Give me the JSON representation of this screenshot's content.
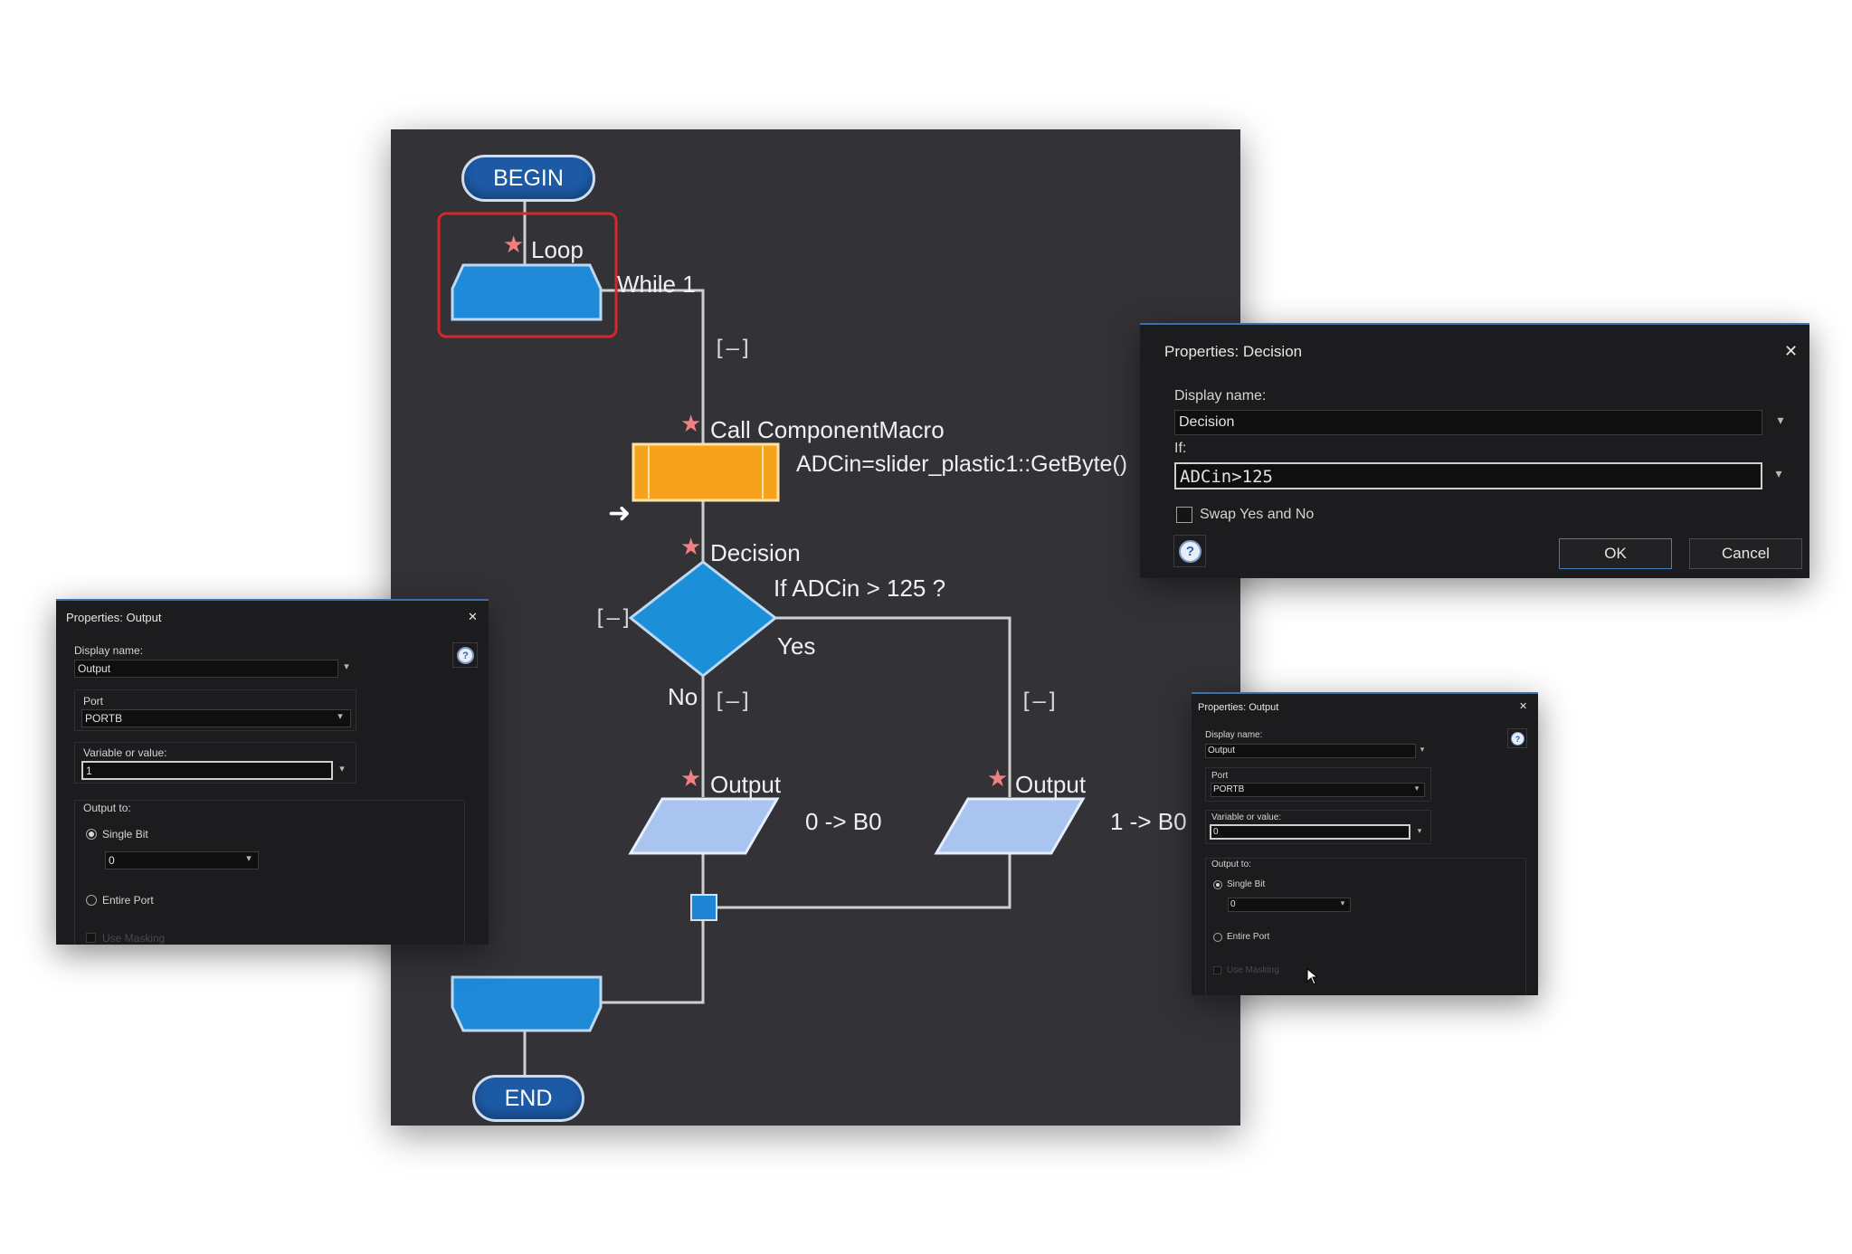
{
  "flowchart": {
    "begin_label": "BEGIN",
    "end_label": "END",
    "loop": {
      "title": "Loop",
      "condition": "While 1"
    },
    "call_macro": {
      "title": "Call ComponentMacro",
      "command": "ADCin=slider_plastic1::GetByte()"
    },
    "decision": {
      "title": "Decision",
      "condition": "If ADCin > 125 ?",
      "yes_label": "Yes",
      "no_label": "No"
    },
    "output_left": {
      "title": "Output",
      "command": "0 -> B0"
    },
    "output_right": {
      "title": "Output",
      "command": "1 -> B0"
    },
    "collapse_glyph": "[–]",
    "star_glyph": "★",
    "arrow_glyph": "➜",
    "colors": {
      "canvas_bg": "#333236",
      "terminal": "#1d5aa6",
      "loop_fill": "#1e8ad8",
      "macro_fill": "#f7a21b",
      "decision_fill": "#1c8fd9",
      "output_fill": "#a9c4ee",
      "connector": "#1f86d6",
      "selection": "#d8262c"
    }
  },
  "decision_dialog": {
    "title": "Properties: Decision",
    "close_glyph": "✕",
    "display_name_label": "Display name:",
    "display_name_value": "Decision",
    "if_label": "If:",
    "if_value": "ADCin>125",
    "swap_label": "Swap Yes and No",
    "swap_checked": false,
    "help_glyph": "?",
    "ok_label": "OK",
    "cancel_label": "Cancel",
    "drop_glyph": "▾"
  },
  "output_dialog_left": {
    "title": "Properties: Output",
    "close_glyph": "✕",
    "display_name_label": "Display name:",
    "display_name_value": "Output",
    "port_label": "Port",
    "port_value": "PORTB",
    "variable_label": "Variable or value:",
    "variable_value": "1",
    "output_to_label": "Output to:",
    "single_bit_label": "Single Bit",
    "single_bit_value": "0",
    "entire_port_label": "Entire Port",
    "use_masking_label": "Use Masking",
    "help_glyph": "?",
    "drop_glyph": "▾"
  },
  "output_dialog_right": {
    "title": "Properties: Output",
    "close_glyph": "✕",
    "display_name_label": "Display name:",
    "display_name_value": "Output",
    "port_label": "Port",
    "port_value": "PORTB",
    "variable_label": "Variable or value:",
    "variable_value": "0",
    "output_to_label": "Output to:",
    "single_bit_label": "Single Bit",
    "single_bit_value": "0",
    "entire_port_label": "Entire Port",
    "use_masking_label": "Use Masking",
    "help_glyph": "?",
    "drop_glyph": "▾"
  }
}
